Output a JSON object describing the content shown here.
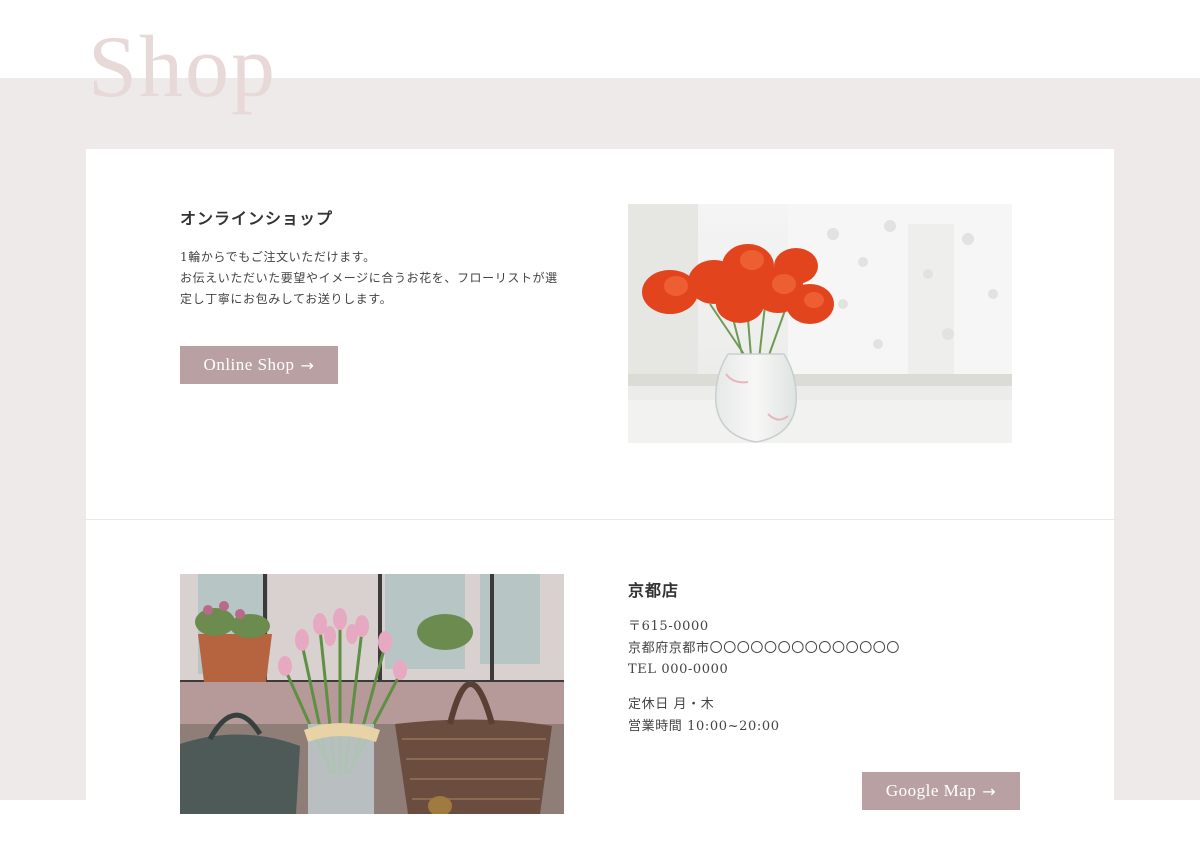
{
  "page": {
    "title": "Shop"
  },
  "online_shop": {
    "title": "オンラインショップ",
    "description_lines": [
      "1輪からでもご注文いただけます。",
      "お伝えいただいた要望やイメージに合うお花を、フローリストが選",
      "定し丁寧にお包みしてお送りします。"
    ],
    "button_label": "Online Shop",
    "button_arrow": "→"
  },
  "kyoto_store": {
    "title": "京都店",
    "postal": "〒615-0000",
    "address": "京都府京都市〇〇〇〇〇〇〇〇〇〇〇〇〇〇",
    "tel_label": "TEL",
    "tel": "000-0000",
    "closed_label": "定休日",
    "closed_days": "月・木",
    "hours_label": "営業時間",
    "hours": "10:00~20:00",
    "button_label": "Google Map",
    "button_arrow": "→"
  },
  "colors": {
    "band": "#efeaea",
    "title": "#e7d9d8",
    "button": "#b9a1a3"
  },
  "icons": [
    "arrow-right-icon"
  ]
}
